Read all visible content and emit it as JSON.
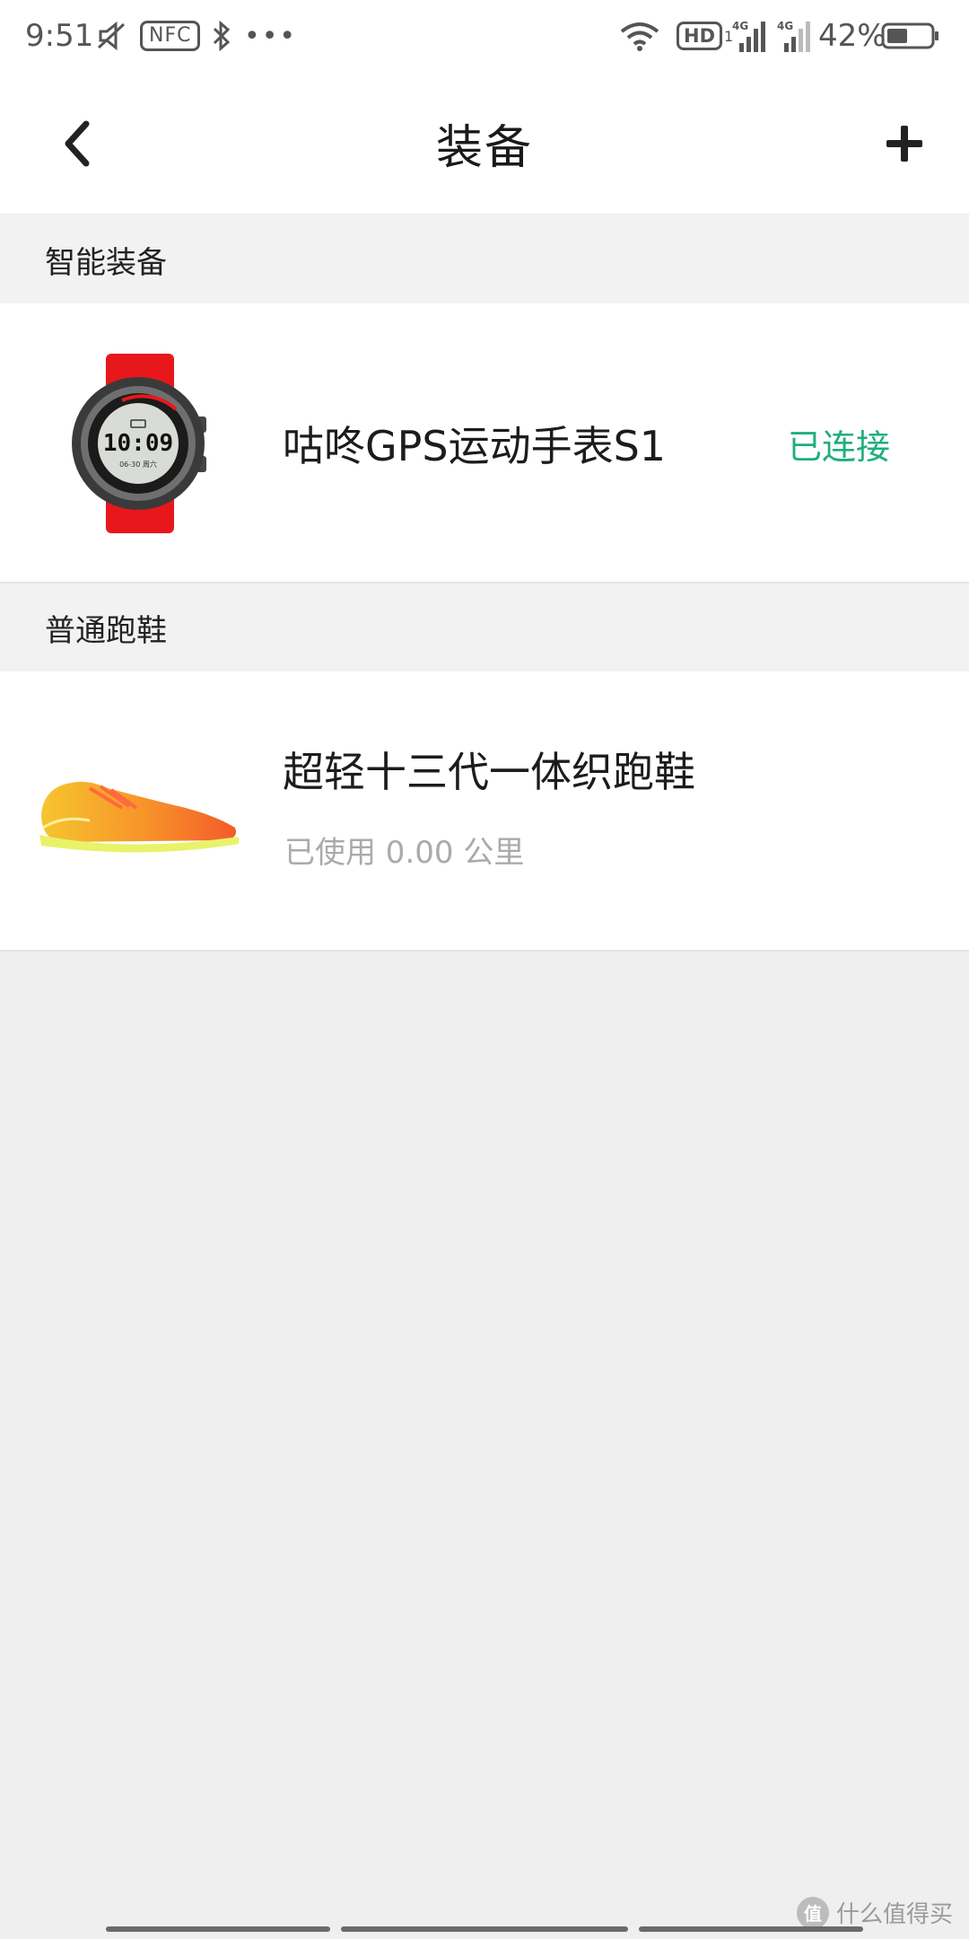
{
  "status_bar": {
    "time": "9:51",
    "nfc_label": "NFC",
    "more": "•••",
    "hd_label": "HD",
    "hd_sub": "1",
    "signal1_label": "4G",
    "signal2_label": "4G",
    "battery_percent": "42%"
  },
  "header": {
    "title": "装备"
  },
  "sections": {
    "smart": {
      "title": "智能装备",
      "item": {
        "name": "咕咚GPS运动手表S1",
        "status": "已连接",
        "status_color": "#1fae7f",
        "watch_time": "10:09",
        "watch_date": "06-30 周六"
      }
    },
    "shoes": {
      "title": "普通跑鞋",
      "item": {
        "name": "超轻十三代一体织跑鞋",
        "used": "已使用 0.00 公里"
      }
    }
  },
  "watermark": {
    "badge": "值",
    "text": "什么值得买"
  }
}
